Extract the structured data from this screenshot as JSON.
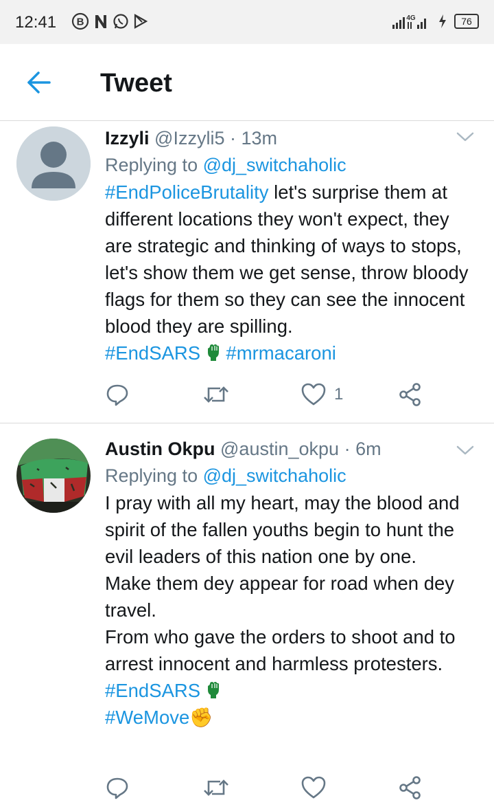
{
  "status_bar": {
    "time": "12:41",
    "network": "4G",
    "battery": "76"
  },
  "header": {
    "title": "Tweet"
  },
  "tweets": [
    {
      "name": "Izzyli",
      "handle": "@Izzyli5",
      "separator": "·",
      "time": "13m",
      "replying_prefix": "Replying to",
      "replying_to": "@dj_switchaholic",
      "hashtag_lead": "#EndPoliceBrutality",
      "text": " let's surprise them at different locations they won't expect, they are strategic and thinking of ways to stops,  let's show them we get sense, throw bloody flags for them so they can see the innocent blood they are spilling.",
      "hashtag_1": "#EndSARS",
      "hashtag_2": "#mrmacaroni",
      "like_count": "1"
    },
    {
      "name": "Austin Okpu",
      "handle": "@austin_okpu",
      "separator": "·",
      "time": "6m",
      "replying_prefix": "Replying to",
      "replying_to": "@dj_switchaholic",
      "line_1": "I pray with all my heart, may the blood and spirit of the fallen youths begin to hunt the evil leaders of this nation one by one.",
      "line_2": "Make them dey appear for road when dey travel.",
      "line_3": "From who gave the orders to shoot and to arrest innocent and harmless protesters. ",
      "hashtag_1": "#EndSARS",
      "hashtag_2": "#WeMove",
      "emoji": "✊",
      "like_count": ""
    }
  ],
  "colors": {
    "accent": "#1b95e0",
    "secondary_text": "#657786",
    "primary_text": "#14171a",
    "divider": "#dadada",
    "fist_green": "#1f8a3a"
  },
  "icons": [
    "back-arrow-icon",
    "caret-down-icon",
    "reply-icon",
    "retweet-icon",
    "like-icon",
    "share-icon",
    "raised-fist-icon"
  ]
}
